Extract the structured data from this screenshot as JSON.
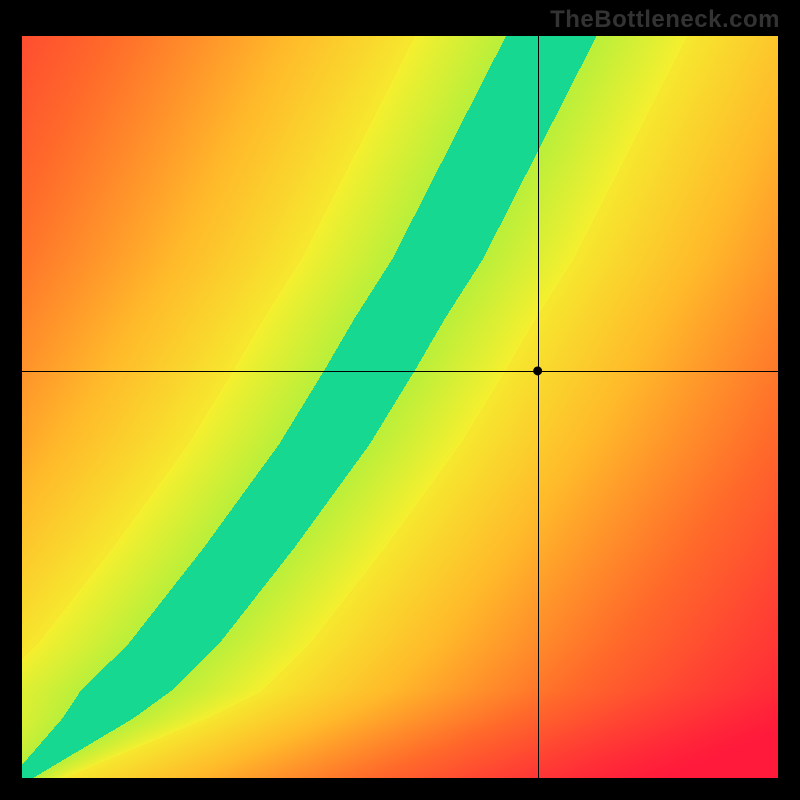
{
  "watermark": "TheBottleneck.com",
  "chart_data": {
    "type": "heatmap",
    "title": "",
    "xlabel": "",
    "ylabel": "",
    "x_range": [
      0,
      100
    ],
    "y_range": [
      0,
      100
    ],
    "crosshair": {
      "x": 68.3,
      "y": 54.8
    },
    "marker": {
      "x": 68.3,
      "y": 54.8
    },
    "ridge_curve_xy": [
      [
        0,
        0
      ],
      [
        10,
        8
      ],
      [
        20,
        18
      ],
      [
        30,
        31
      ],
      [
        40,
        45
      ],
      [
        46,
        55
      ],
      [
        50,
        62
      ],
      [
        55,
        70
      ],
      [
        60,
        80
      ],
      [
        65,
        90
      ],
      [
        70,
        100
      ]
    ],
    "green_band_width_fraction": 0.06,
    "yellow_falloff_fraction": 0.12,
    "gradient": {
      "stops": [
        {
          "t": 0.0,
          "color": "#ff1a3b"
        },
        {
          "t": 0.3,
          "color": "#ff6a2a"
        },
        {
          "t": 0.55,
          "color": "#ffb92a"
        },
        {
          "t": 0.78,
          "color": "#f5ef2f"
        },
        {
          "t": 0.9,
          "color": "#b9ef3a"
        },
        {
          "t": 1.0,
          "color": "#16d890"
        }
      ]
    },
    "heat_samples_note": "Field value at (x,y) is 1 minus normalized horizontal distance from the ridge curve; green at 1, red at 0.",
    "heat_samples": [
      {
        "x": 0,
        "y": 0,
        "score": 1.0
      },
      {
        "x": 50,
        "y": 62,
        "score": 1.0
      },
      {
        "x": 70,
        "y": 100,
        "score": 1.0
      },
      {
        "x": 68,
        "y": 55,
        "score": 0.55
      },
      {
        "x": 100,
        "y": 100,
        "score": 0.3
      },
      {
        "x": 100,
        "y": 0,
        "score": 0.0
      },
      {
        "x": 0,
        "y": 100,
        "score": 0.0
      }
    ]
  }
}
